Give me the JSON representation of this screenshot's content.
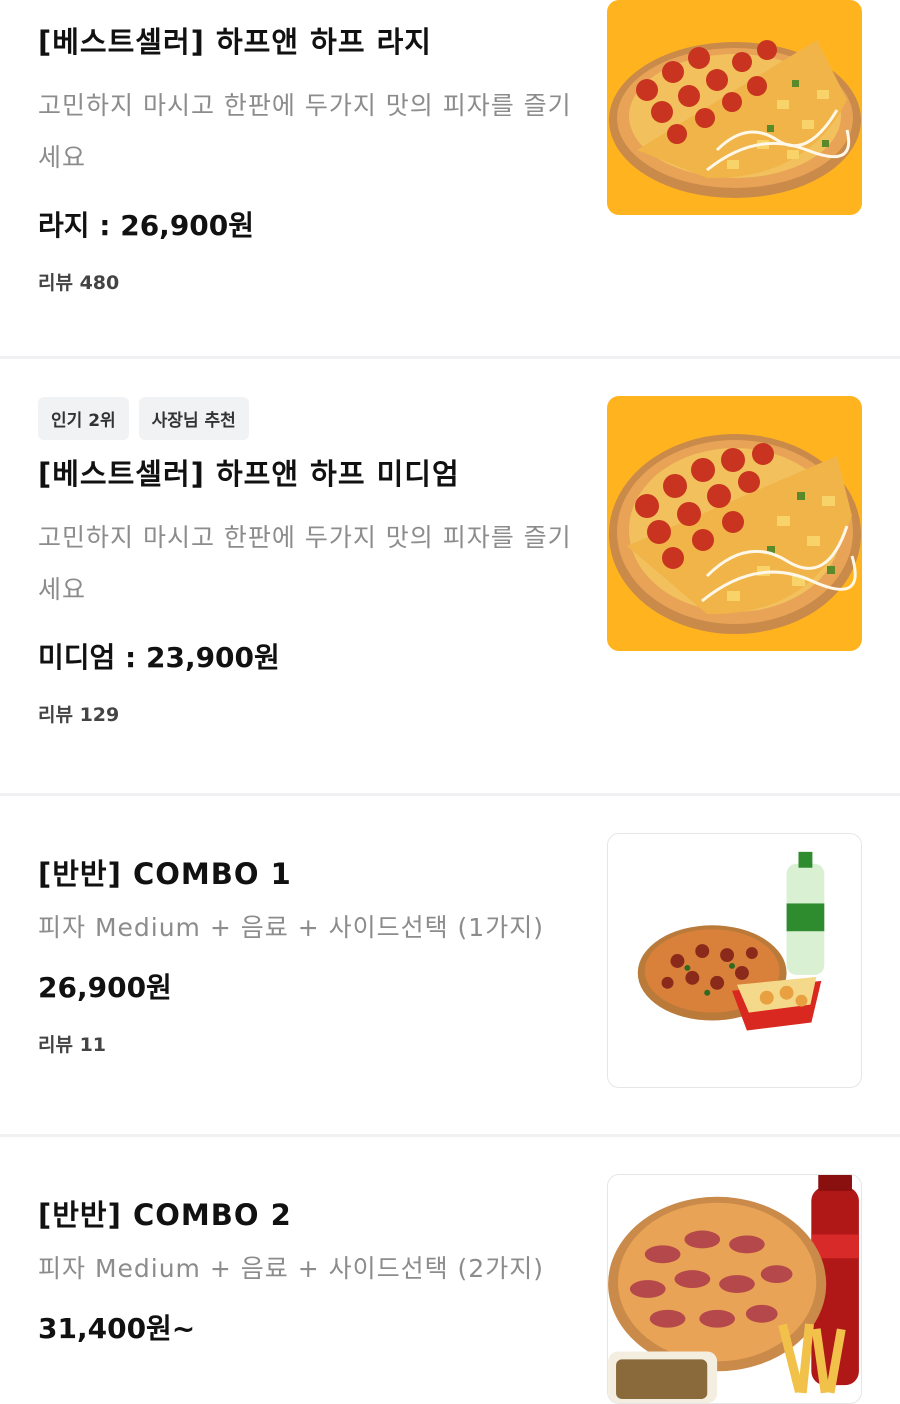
{
  "items": [
    {
      "title": "[베스트셀러] 하프앤 하프 라지",
      "badges": [],
      "description": "고민하지 마시고 한판에 두가지 맛의 피자를 즐기세요",
      "price": "라지 : 26,900원",
      "reviews": "리뷰 480",
      "image": "half-and-half-pizza-image"
    },
    {
      "title": "[베스트셀러] 하프앤 하프 미디엄",
      "badges": [
        "인기 2위",
        "사장님 추천"
      ],
      "description": "고민하지 마시고 한판에 두가지 맛의 피자를 즐기세요",
      "price": "미디엄 : 23,900원",
      "reviews": "리뷰 129",
      "image": "half-and-half-pizza-image"
    },
    {
      "title": "[반반] COMBO 1",
      "badges": [],
      "description": "피자 Medium + 음료 + 사이드선택 (1가지)",
      "price": "26,900원",
      "reviews": "리뷰 11",
      "image": "combo-pizza-soda-fries-image"
    },
    {
      "title": "[반반] COMBO 2",
      "badges": [],
      "description": "피자 Medium + 음료 + 사이드선택 (2가지)",
      "price": "31,400원~",
      "reviews": "",
      "image": "combo-pizza-cola-fries-image"
    }
  ],
  "colors": {
    "thumb_background": "#ffb41f",
    "description_text": "#8c8c8c",
    "badge_background": "#f1f2f4"
  }
}
